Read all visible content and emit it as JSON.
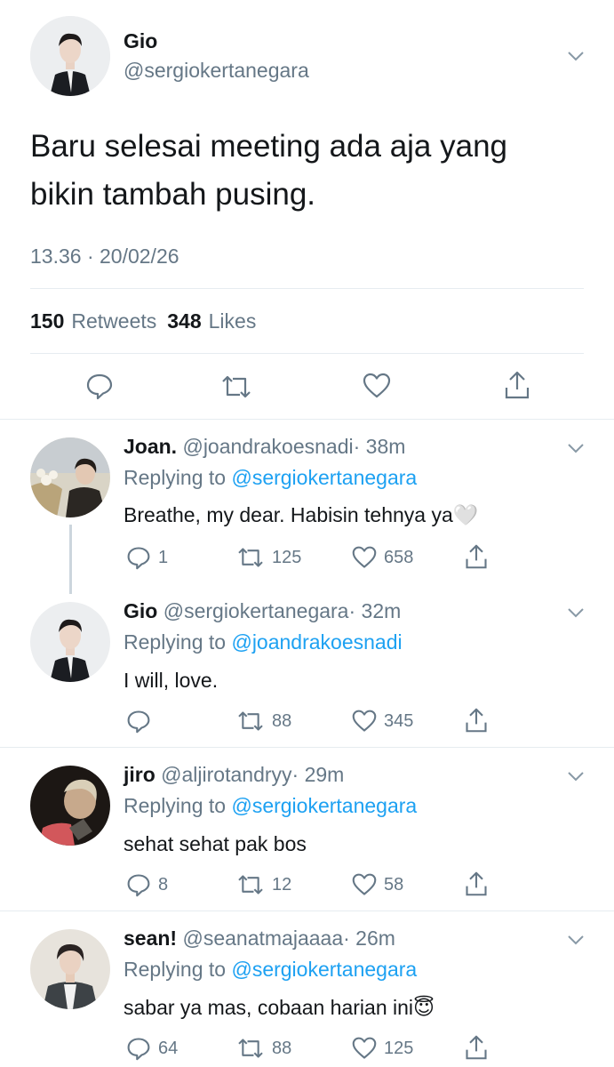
{
  "main_tweet": {
    "display_name": "Gio",
    "handle": "@sergiokertanegara",
    "text_line1": "Baru selesai meeting ada aja yang",
    "text_line2": "bikin tambah pusing.",
    "timestamp": "13.36 · 20/02/26",
    "retweets_count": "150",
    "retweets_label": "Retweets",
    "likes_count": "348",
    "likes_label": "Likes"
  },
  "replies": [
    {
      "name": "Joan.",
      "handle": "@joandrakoesnadi",
      "age": "· 38m",
      "replying_prefix": "Replying to",
      "replying_to": "@sergiokertanegara",
      "text": "Breathe, my dear. Habisin tehnya ya",
      "emoji": "🤍",
      "reply_count": "1",
      "retweet_count": "125",
      "like_count": "658"
    },
    {
      "name": "Gio",
      "handle": "@sergiokertanegara",
      "age": "· 32m",
      "replying_prefix": "Replying to",
      "replying_to": "@joandrakoesnadi",
      "text": "I will, love.",
      "emoji": "",
      "reply_count": "",
      "retweet_count": "88",
      "like_count": "345"
    },
    {
      "name": "jiro",
      "handle": "@aljirotandryy",
      "age": "· 29m",
      "replying_prefix": "Replying to",
      "replying_to": "@sergiokertanegara",
      "text": "sehat sehat pak bos",
      "emoji": "",
      "reply_count": "8",
      "retweet_count": "12",
      "like_count": "58"
    },
    {
      "name": "sean!",
      "handle": "@seanatmajaaaa",
      "age": "· 26m",
      "replying_prefix": "Replying to",
      "replying_to": "@sergiokertanegara",
      "text": "sabar ya mas, cobaan harian ini",
      "emoji": "😇",
      "reply_count": "64",
      "retweet_count": "88",
      "like_count": "125"
    }
  ],
  "icons": [
    "chevron-down-icon",
    "reply-icon",
    "retweet-icon",
    "like-icon",
    "share-icon"
  ],
  "colors": {
    "link": "#1da1f2",
    "muted": "#657786",
    "text": "#14171a",
    "divider": "#e6ecf0"
  }
}
